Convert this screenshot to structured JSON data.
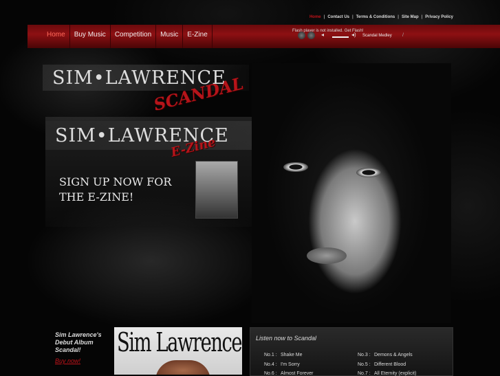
{
  "top_links": [
    "Home",
    "Contact Us",
    "Terms & Conditions",
    "Site Map",
    "Privacy Policy"
  ],
  "nav": [
    "Home",
    "Buy Music",
    "Competition",
    "Music",
    "E-Zine"
  ],
  "player": {
    "flash_message": "Flash player is not installed. Get Flash!",
    "track": "Scandal Medley"
  },
  "logo": {
    "name": "SIM•LAWRENCE",
    "scandal": "SCANDAL",
    "ezine_name": "SIM•LAWRENCE",
    "ezine": "E-Zine"
  },
  "signup": {
    "line1": "SIGN UP NOW FOR",
    "line2": "THE E-ZINE!"
  },
  "promo": {
    "line1": "Sim Lawrence's",
    "line2": "Debut Album",
    "line3": "Scandal!",
    "buy": "Buy now!"
  },
  "album": {
    "title": "Sim Lawrence"
  },
  "listen": {
    "title": "Listen now to Scandal",
    "songs": [
      {
        "no": "No.1 :",
        "title": "Shake Me"
      },
      {
        "no": "No.4 :",
        "title": "I'm Sorry"
      },
      {
        "no": "No.6 :",
        "title": "Almost Forever"
      },
      {
        "no": "No.3 :",
        "title": "Demons & Angels"
      },
      {
        "no": "No.5 :",
        "title": "Different Blood"
      },
      {
        "no": "No.7 :",
        "title": "All Eternity (explicit)"
      }
    ]
  },
  "colors": {
    "accent": "#c0131a",
    "navbar": "#8d1013"
  }
}
